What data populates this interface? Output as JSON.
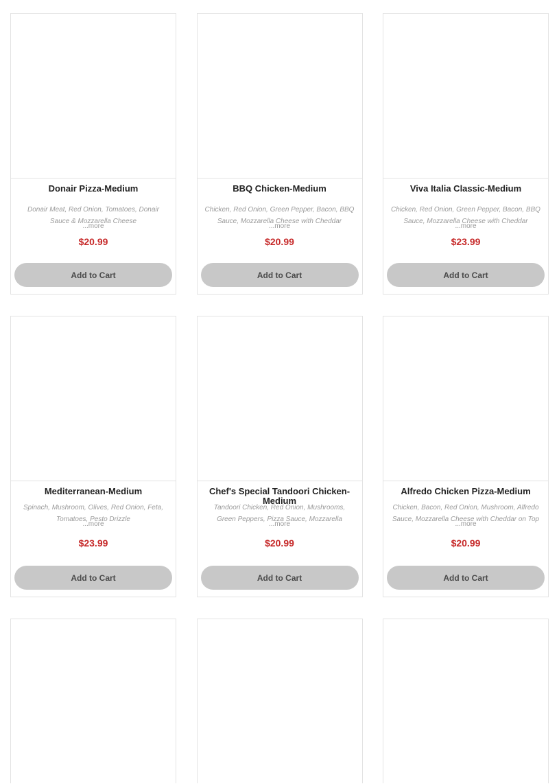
{
  "products": [
    {
      "title": "Donair Pizza-Medium",
      "description": "Donair Meat, Red Onion, Tomatoes, Donair Sauce & Mozzarella Cheese",
      "more": "...more",
      "price": "$20.99",
      "cart_label": "Add to Cart"
    },
    {
      "title": "BBQ Chicken-Medium",
      "description": "Chicken, Red Onion, Green Pepper, Bacon, BBQ Sauce, Mozzarella Cheese with Cheddar",
      "more": "...more",
      "price": "$20.99",
      "cart_label": "Add to Cart"
    },
    {
      "title": "Viva Italia Classic-Medium",
      "description": "Chicken, Red Onion, Green Pepper, Bacon, BBQ Sauce, Mozzarella Cheese with Cheddar",
      "more": "...more",
      "price": "$23.99",
      "cart_label": "Add to Cart"
    },
    {
      "title": "Mediterranean-Medium",
      "description": "Spinach, Mushroom, Olives, Red Onion, Feta, Tomatoes, Pesto Drizzle",
      "more": "...more",
      "price": "$23.99",
      "cart_label": "Add to Cart"
    },
    {
      "title": "Chef's Special Tandoori Chicken-Medium",
      "description": "Tandoori Chicken, Red Onion, Mushrooms, Green Peppers, Pizza Sauce, Mozzarella",
      "more": "...more",
      "price": "$20.99",
      "cart_label": "Add to Cart"
    },
    {
      "title": "Alfredo Chicken Pizza-Medium",
      "description": "Chicken, Bacon, Red Onion, Mushroom, Alfredo Sauce, Mozzarella Cheese with Cheddar on Top",
      "more": "...more",
      "price": "$20.99",
      "cart_label": "Add to Cart"
    }
  ],
  "colors": {
    "price": "#c62828",
    "button_bg": "#c8c8c8",
    "border": "#e3e3e3"
  }
}
